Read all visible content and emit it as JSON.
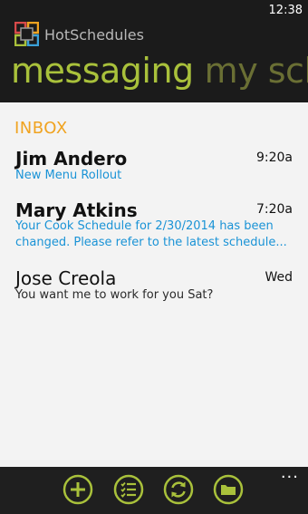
{
  "status_bar": {
    "time": "12:38"
  },
  "app": {
    "name": "HotSchedules"
  },
  "pivot": {
    "active": "messaging",
    "next": "my schedule"
  },
  "inbox": {
    "heading": "INBOX",
    "messages": [
      {
        "sender": "Jim Andero",
        "time": "9:20a",
        "preview": "New Menu Rollout",
        "unread": true
      },
      {
        "sender": "Mary Atkins",
        "time": "7:20a",
        "preview": "Your Cook Schedule for 2/30/2014 has been changed. Please refer to the latest schedule...",
        "unread": true
      },
      {
        "sender": "Jose Creola",
        "time": "Wed",
        "preview": "You want me to work for you Sat?",
        "unread": false
      }
    ]
  },
  "app_bar": {
    "icons": [
      "add-icon",
      "checklist-icon",
      "sync-icon",
      "folder-icon",
      "more-icon"
    ],
    "more_label": "...",
    "accent_color": "#a9c13b"
  },
  "colors": {
    "accent": "#a9c13b",
    "inbox_heading": "#f0a320",
    "link_blue": "#1a93d6",
    "header_bg": "#1b1b1b"
  }
}
